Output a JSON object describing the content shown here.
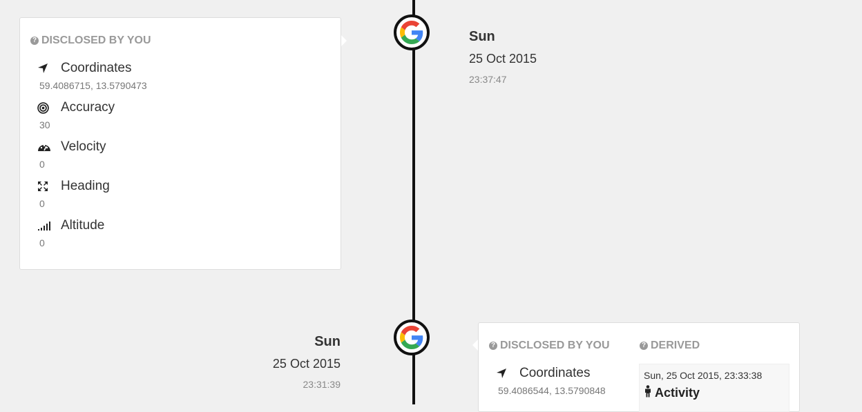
{
  "entries": [
    {
      "day": "Sun",
      "date": "25 Oct 2015",
      "time": "23:37:47",
      "disclosed_heading": "DISCLOSED BY YOU",
      "items": [
        {
          "label": "Coordinates",
          "value": "59.4086715, 13.5790473",
          "icon": "location-arrow-icon"
        },
        {
          "label": "Accuracy",
          "value": "30",
          "icon": "bullseye-icon"
        },
        {
          "label": "Velocity",
          "value": "0",
          "icon": "dashboard-icon"
        },
        {
          "label": "Heading",
          "value": "0",
          "icon": "arrows-icon"
        },
        {
          "label": "Altitude",
          "value": "0",
          "icon": "signal-icon"
        }
      ]
    },
    {
      "day": "Sun",
      "date": "25 Oct 2015",
      "time": "23:31:39",
      "disclosed_heading": "DISCLOSED BY YOU",
      "derived_heading": "DERIVED",
      "items": [
        {
          "label": "Coordinates",
          "value": "59.4086544, 13.5790848",
          "icon": "location-arrow-icon"
        }
      ],
      "derived": {
        "timestamp": "Sun, 25 Oct 2015, 23:33:38",
        "title": "Activity",
        "icon": "male-icon"
      }
    }
  ],
  "node_icon": "google-icon",
  "colors": {
    "google_blue": "#4285F4",
    "google_red": "#EA4335",
    "google_yellow": "#FBBC05",
    "google_green": "#34A853"
  }
}
